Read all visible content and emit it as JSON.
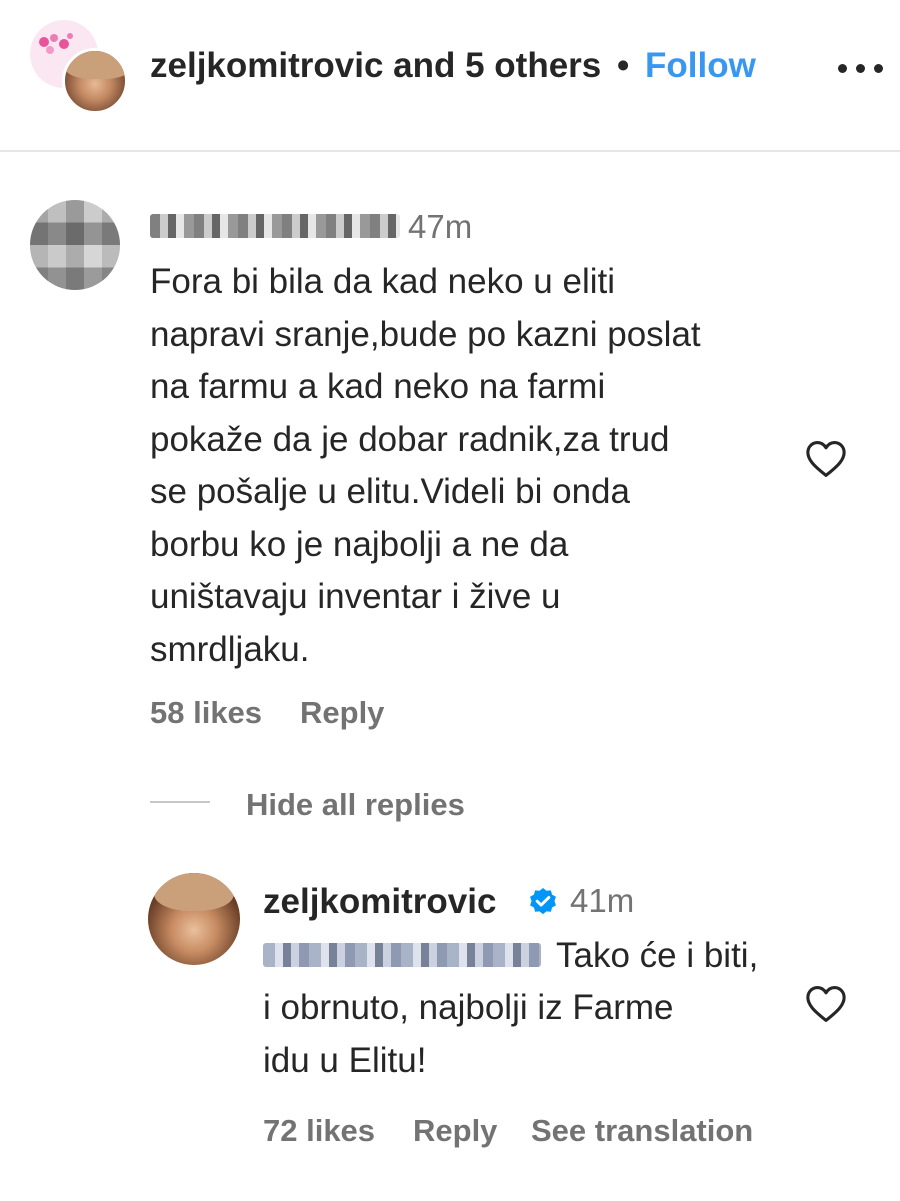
{
  "header": {
    "username": "zeljkomitrovic",
    "others": "and 5 others",
    "separator": "•",
    "follow_label": "Follow"
  },
  "comments": [
    {
      "time": "47m",
      "text": "Fora bi bila da kad neko u eliti\nnapravi sranje,bude po kazni poslat\nna farmu a kad neko na farmi\npokaže da je dobar radnik,za trud\nse pošalje u elitu.Videli bi onda\nborbu ko je najbolji a ne da\nuništavaju inventar i žive u\nsmrdljaku.",
      "likes": "58 likes",
      "reply_label": "Reply",
      "hide_replies_label": "Hide all replies",
      "replies": [
        {
          "username": "zeljkomitrovic",
          "verified": true,
          "time": "41m",
          "text_first_line": "Tako će i biti,",
          "text_rest": "i obrnuto, najbolji iz Farme\nidu u Elitu!",
          "likes": "72 likes",
          "reply_label": "Reply",
          "translation_label": "See translation"
        }
      ]
    }
  ],
  "colors": {
    "text": "#262626",
    "muted": "#737373",
    "follow": "#3897f0",
    "verified": "#0095f6",
    "divider": "#e6e6e6"
  }
}
